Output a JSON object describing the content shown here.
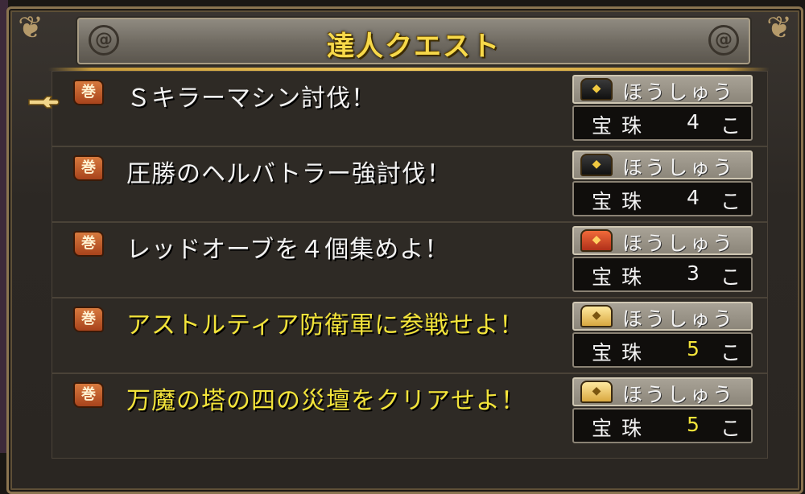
{
  "window": {
    "title": "達人クエスト"
  },
  "quests": [
    {
      "name": "Ｓキラーマシン討伐！",
      "highlight": false,
      "chest": "black",
      "reward_label": "ほうしゅう",
      "item": "宝珠",
      "qty": "4",
      "unit": "こ"
    },
    {
      "name": "圧勝のヘルバトラー強討伐！",
      "highlight": false,
      "chest": "black",
      "reward_label": "ほうしゅう",
      "item": "宝珠",
      "qty": "4",
      "unit": "こ"
    },
    {
      "name": "レッドオーブを４個集めよ！",
      "highlight": false,
      "chest": "red",
      "reward_label": "ほうしゅう",
      "item": "宝珠",
      "qty": "3",
      "unit": "こ"
    },
    {
      "name": "アストルティア防衛軍に参戦せよ！",
      "highlight": true,
      "chest": "gold",
      "reward_label": "ほうしゅう",
      "item": "宝珠",
      "qty": "5",
      "unit": "こ"
    },
    {
      "name": "万魔の塔の四の災壇をクリアせよ！",
      "highlight": true,
      "chest": "gold",
      "reward_label": "ほうしゅう",
      "item": "宝珠",
      "qty": "5",
      "unit": "こ"
    }
  ],
  "selected_index": 0,
  "icons": {
    "quest": "scroll-icon",
    "cursor": "pointing-hand-icon",
    "reward": "treasure-chest-icon"
  },
  "colors": {
    "title_gold": "#f7d94a",
    "highlight_text": "#f3e43a",
    "normal_text": "#f2f2f2"
  }
}
